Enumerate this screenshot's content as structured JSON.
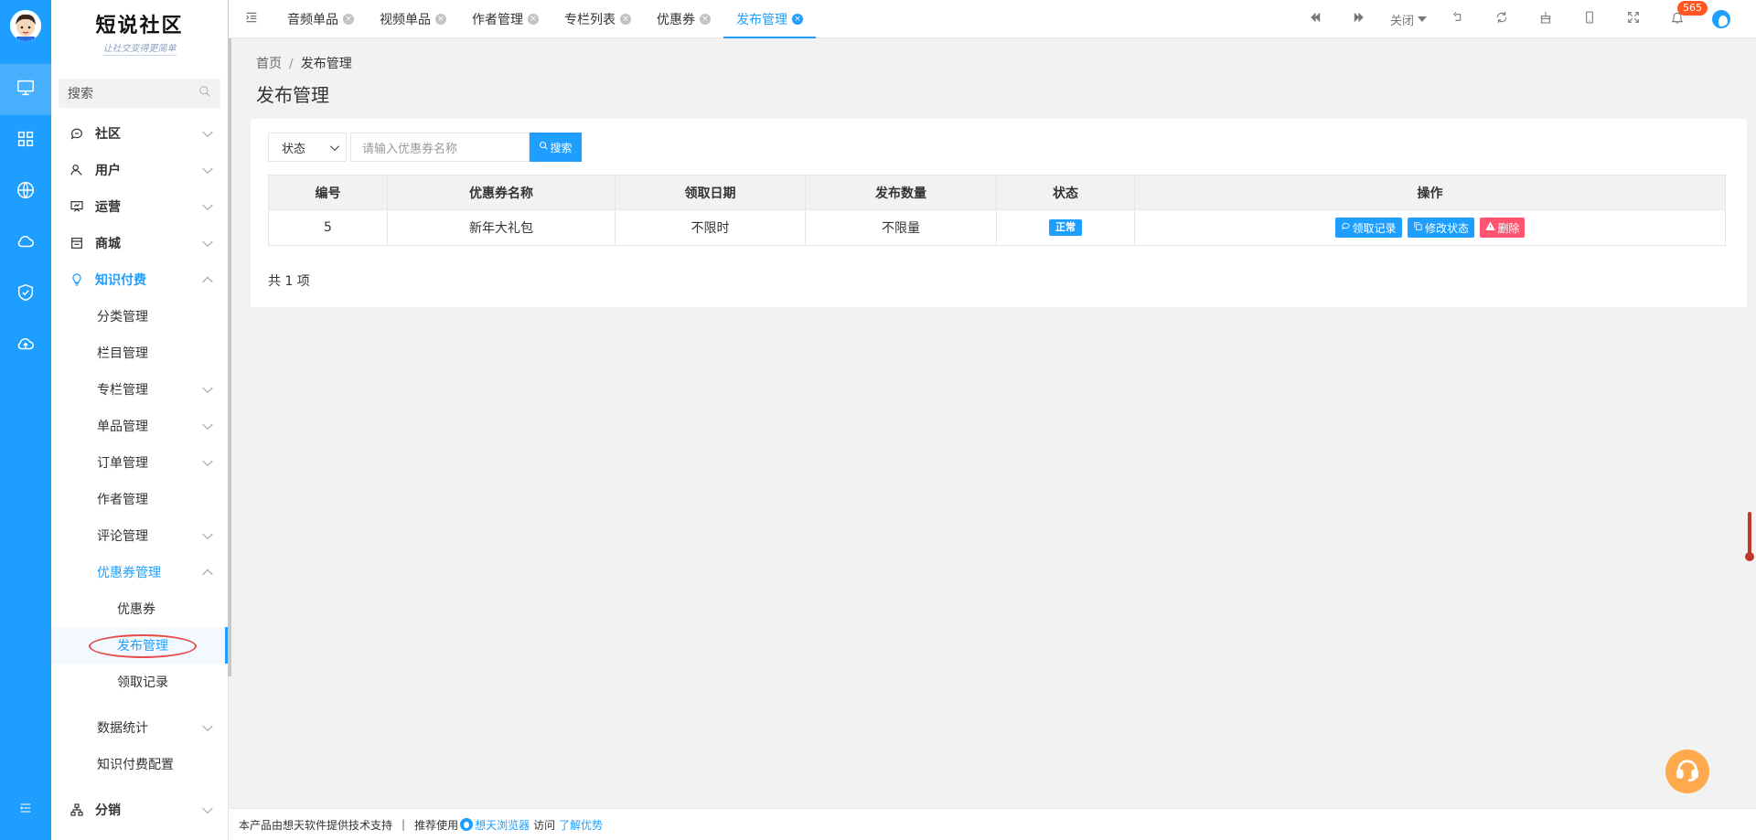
{
  "brand": {
    "title": "短说社区",
    "subtitle": "让社交变得更简单"
  },
  "rail": {
    "icons": [
      "monitor-icon",
      "grid-icon",
      "globe-icon",
      "cloud-icon",
      "shield-check-icon",
      "cloud-upload-icon",
      "menu-toggle-icon"
    ]
  },
  "sidebar": {
    "search_label": "搜索",
    "menu": [
      {
        "label": "社区",
        "icon": "chat-icon"
      },
      {
        "label": "用户",
        "icon": "user-icon"
      },
      {
        "label": "运营",
        "icon": "presentation-icon"
      },
      {
        "label": "商城",
        "icon": "store-icon"
      },
      {
        "label": "知识付费",
        "icon": "lightbulb-icon"
      }
    ],
    "knowledge_sub": [
      {
        "label": "分类管理"
      },
      {
        "label": "栏目管理"
      },
      {
        "label": "专栏管理"
      },
      {
        "label": "单品管理"
      },
      {
        "label": "订单管理"
      },
      {
        "label": "作者管理"
      },
      {
        "label": "评论管理"
      },
      {
        "label": "优惠券管理"
      }
    ],
    "coupon_sub": [
      {
        "label": "优惠券"
      },
      {
        "label": "发布管理"
      },
      {
        "label": "领取记录"
      }
    ],
    "after_sub": [
      {
        "label": "数据统计"
      },
      {
        "label": "知识付费配置"
      }
    ],
    "bottom_menu": {
      "label": "分销",
      "icon": "sitemap-icon"
    }
  },
  "tabs": [
    {
      "label": "音频单品"
    },
    {
      "label": "视频单品"
    },
    {
      "label": "作者管理"
    },
    {
      "label": "专栏列表"
    },
    {
      "label": "优惠券"
    },
    {
      "label": "发布管理"
    }
  ],
  "toolbar": {
    "close_label": "关闭",
    "notification_count": "565"
  },
  "breadcrumb": {
    "home": "首页",
    "separator": "/",
    "current": "发布管理"
  },
  "page": {
    "title": "发布管理"
  },
  "filters": {
    "status_label": "状态",
    "coupon_placeholder": "请输入优惠券名称",
    "search_button": "搜索"
  },
  "table": {
    "headers": [
      "编号",
      "优惠券名称",
      "领取日期",
      "发布数量",
      "状态",
      "操作"
    ],
    "rows": [
      {
        "id": "5",
        "name": "新年大礼包",
        "date": "不限时",
        "quantity": "不限量",
        "status": "正常",
        "actions": {
          "records": "领取记录",
          "modify": "修改状态",
          "delete": "删除"
        }
      }
    ],
    "total": "共 1 项"
  },
  "footer": {
    "support_text": "本产品由想天软件提供技术支持",
    "divider": "|",
    "recommend": "推荐使用",
    "browser": "想天浏览器",
    "visit": "访问",
    "learn": "了解优势"
  },
  "colors": {
    "primary": "#1E9FFF",
    "danger": "#FF5470",
    "support": "#FFA94D"
  }
}
